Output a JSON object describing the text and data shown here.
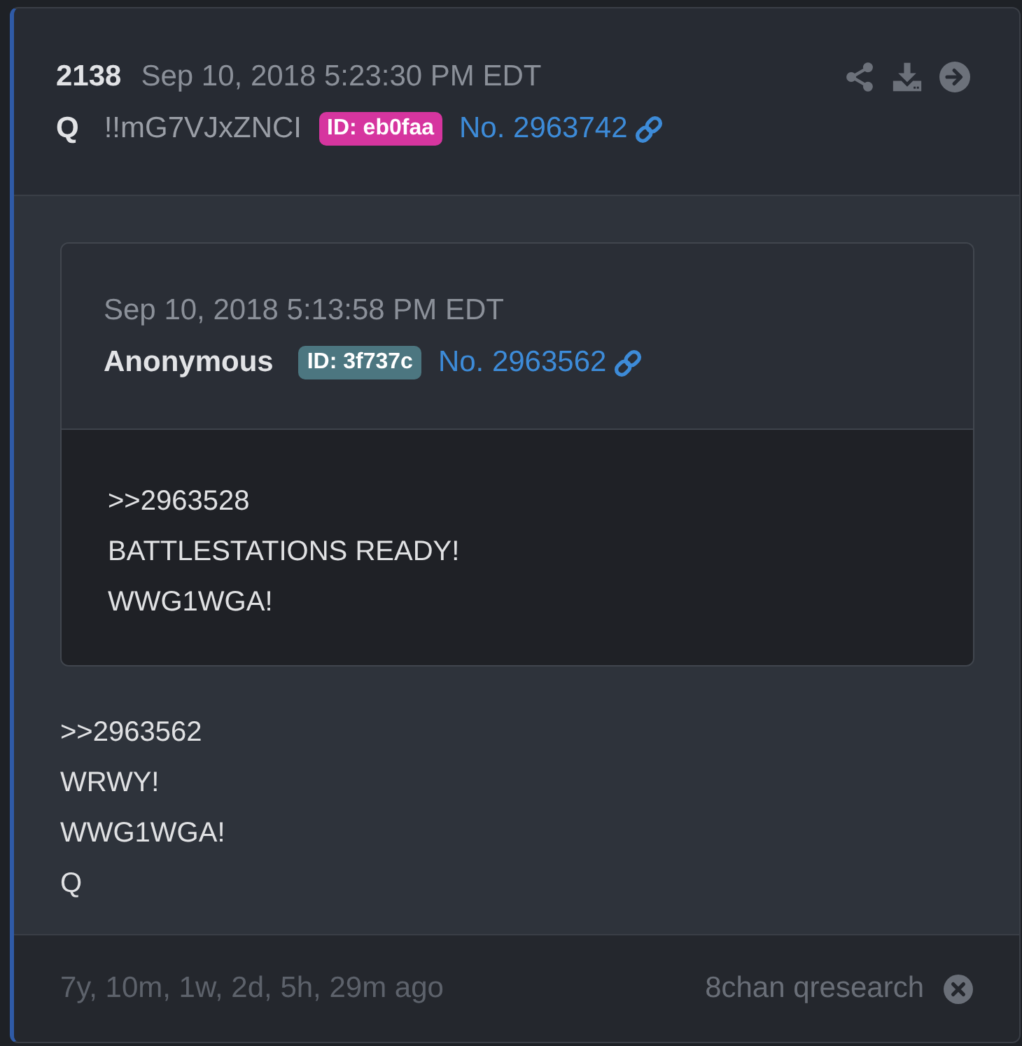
{
  "post": {
    "number": "2138",
    "date": "Sep 10, 2018 5:23:30 PM EDT",
    "author": "Q",
    "tripcode": "!!mG7VJxZNCI",
    "id_badge": {
      "text": "ID: eb0faa",
      "color": "#d6359f"
    },
    "post_link": "No. 2963742"
  },
  "quoted_post": {
    "date": "Sep 10, 2018 5:13:58 PM EDT",
    "author": "Anonymous",
    "id_badge": {
      "text": "ID: 3f737c",
      "color": "#4c7680"
    },
    "post_link": "No. 2963562",
    "lines": [
      ">>2963528",
      "BATTLESTATIONS READY!",
      "WWG1WGA!"
    ]
  },
  "lines": [
    ">>2963562",
    "WRWY!",
    "WWG1WGA!",
    "Q"
  ],
  "footer": {
    "age": "7y, 10m, 1w, 2d, 5h, 29m ago",
    "source": "8chan qresearch"
  }
}
